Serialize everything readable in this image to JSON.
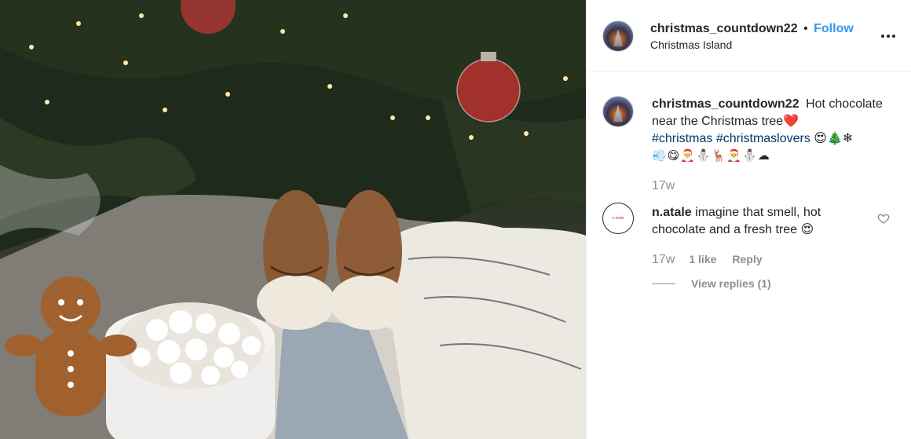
{
  "post": {
    "username": "christmas_countdown22",
    "separator": "•",
    "follow_label": "Follow",
    "location": "Christmas Island"
  },
  "caption": {
    "username": "christmas_countdown22",
    "text_before": "Hot chocolate near the Christmas tree",
    "heart_emoji": "❤️",
    "hashtags": [
      "#christmas",
      "#christmaslovers"
    ],
    "emoji_tail": "😍🎄❄",
    "emoji_line": "💨😋🎅⛄🦌🎅⛄☁",
    "time": "17w"
  },
  "comment": {
    "username": "n.atale",
    "avatar_text": "n.atale",
    "text": "imagine that smell, hot chocolate and a fresh tree",
    "emoji": "😍",
    "time": "17w",
    "likes": "1 like",
    "reply_label": "Reply",
    "view_replies": "View replies (1)"
  },
  "icons": {
    "more": "more-horizontal-icon",
    "like": "heart-outline-icon"
  },
  "colors": {
    "follow": "#3897f0",
    "hashtag": "#00376b",
    "muted": "#8e8e8e"
  }
}
